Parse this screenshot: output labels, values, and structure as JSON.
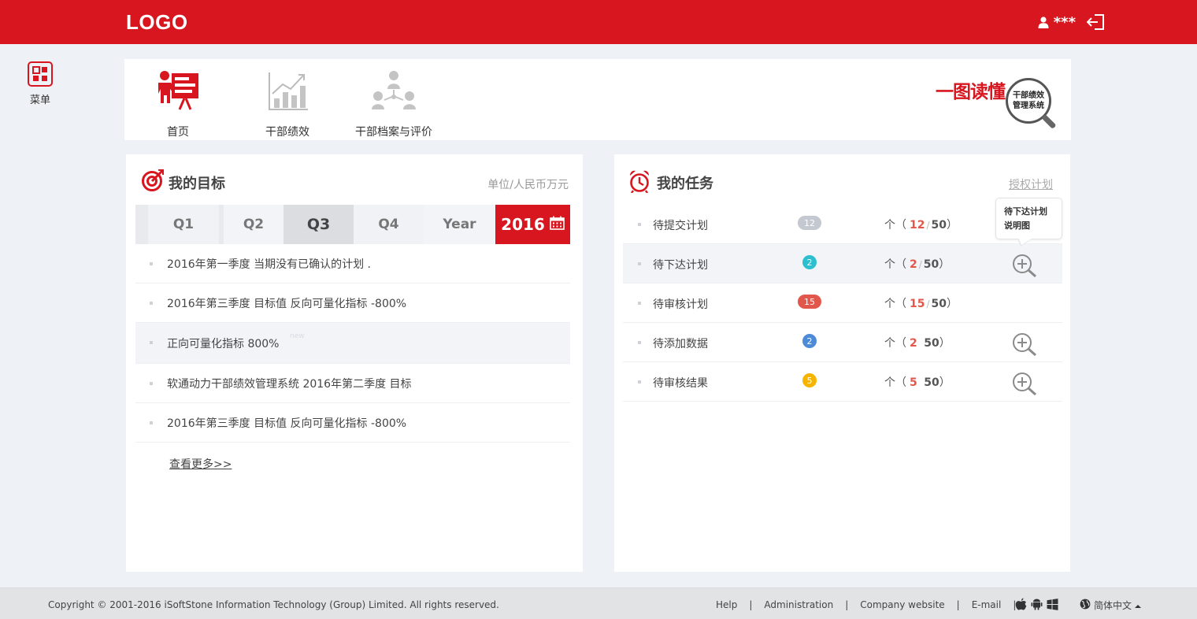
{
  "header": {
    "logo": "LOGO",
    "user_name": "***",
    "brand_color": "#d7161f"
  },
  "side_menu": {
    "label": "菜单",
    "icon": "grid-menu-icon"
  },
  "nav": {
    "items": [
      {
        "label": "首页",
        "icon": "presentation-icon",
        "active": true
      },
      {
        "label": "干部绩效",
        "icon": "bar-chart-icon",
        "active": false
      },
      {
        "label": "干部档案与评价",
        "icon": "org-chart-icon",
        "active": false
      }
    ],
    "banner": {
      "title": "一图读懂",
      "lens_line1": "干部绩效",
      "lens_line2": "管理系统"
    }
  },
  "goals": {
    "title": "我的目标",
    "unit": "单位/人民币万元",
    "tabs": [
      "Q1",
      "Q2",
      "Q3",
      "Q4",
      "Year",
      "2016"
    ],
    "active_tab": "Q3",
    "items": [
      {
        "text": "2016年第一季度 当期没有已确认的计划 ."
      },
      {
        "text": "2016年第三季度 目标值 反向可量化指标 -800%"
      },
      {
        "text": "正向可量化指标 800%",
        "tag": "new"
      },
      {
        "text": "软通动力干部绩效管理系统  2016年第二季度 目标"
      },
      {
        "text": "2016年第三季度 目标值 反向可量化指标 -800%"
      }
    ],
    "more_label": "查看更多>>"
  },
  "tasks": {
    "title": "我的任务",
    "link": "授权计划",
    "tooltip_line1": "待下达计划",
    "tooltip_line2": "说明图",
    "unit_prefix": "个（",
    "unit_suffix": "）",
    "items": [
      {
        "name": "待提交计划",
        "badge": "12",
        "badge_color": "#c4c8d0",
        "current": "12",
        "total": "50",
        "sep": "/",
        "zoom": false
      },
      {
        "name": "待下达计划",
        "badge": "2",
        "badge_color": "#2bbfcf",
        "current": "2",
        "total": "50",
        "sep": "/",
        "zoom": true
      },
      {
        "name": "待审核计划",
        "badge": "15",
        "badge_color": "#e2574c",
        "current": "15",
        "total": "50",
        "sep": "/",
        "zoom": false
      },
      {
        "name": "待添加数据",
        "badge": "2",
        "badge_color": "#4d8ad8",
        "current": "2",
        "total": "50",
        "sep": "",
        "zoom": true
      },
      {
        "name": "待审核结果",
        "badge": "5",
        "badge_color": "#f5b400",
        "current": "5",
        "total": "50",
        "sep": "",
        "zoom": true
      }
    ]
  },
  "footer": {
    "copyright": "Copyright © 2001-2016 iSoftStone Information Technology (Group) Limited. All rights reserved.",
    "links": [
      "Help",
      "Administration",
      "Company website",
      "E-mail"
    ],
    "language": "简体中文"
  }
}
